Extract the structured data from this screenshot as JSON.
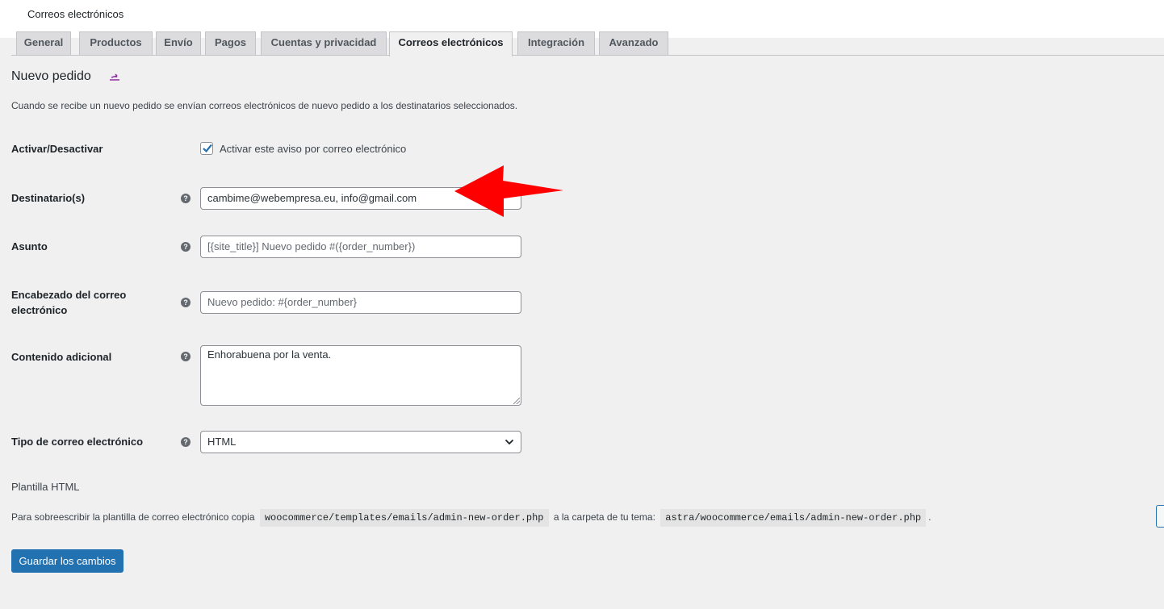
{
  "page": {
    "title": "Correos electrónicos"
  },
  "tabs": [
    {
      "label": "General"
    },
    {
      "label": "Productos"
    },
    {
      "label": "Envío"
    },
    {
      "label": "Pagos"
    },
    {
      "label": "Cuentas y privacidad"
    },
    {
      "label": "Correos electrónicos"
    },
    {
      "label": "Integración"
    },
    {
      "label": "Avanzado"
    }
  ],
  "active_tab": "Correos electrónicos",
  "section": {
    "heading": "Nuevo pedido",
    "description": "Cuando se recibe un nuevo pedido se envían correos electrónicos de nuevo pedido a los destinatarios seleccionados."
  },
  "fields": {
    "enable": {
      "label": "Activar/Desactivar",
      "checkbox_label": "Activar este aviso por correo electrónico",
      "checked": true
    },
    "recipient": {
      "label": "Destinatario(s)",
      "value": "cambime@webempresa.eu, info@gmail.com"
    },
    "subject": {
      "label": "Asunto",
      "placeholder": "[{site_title}] Nuevo pedido #({order_number})"
    },
    "heading": {
      "label": "Encabezado del correo electrónico",
      "placeholder": "Nuevo pedido: #{order_number}"
    },
    "additional": {
      "label": "Contenido adicional",
      "value": "Enhorabuena por la venta."
    },
    "type": {
      "label": "Tipo de correo electrónico",
      "value": "HTML"
    }
  },
  "template": {
    "title": "Plantilla HTML",
    "text_before": "Para sobreescribir la plantilla de correo electrónico copia",
    "source_path": "woocommerce/templates/emails/admin-new-order.php",
    "text_middle": "a la carpeta de tu tema:",
    "theme_path": "astra/woocommerce/emails/admin-new-order.php",
    "text_after": "."
  },
  "save_button": "Guardar los cambios",
  "help_icon_glyph": "?",
  "colors": {
    "primary": "#2271b1",
    "annotation_arrow": "#ff0000",
    "background": "#f0f0f1"
  }
}
